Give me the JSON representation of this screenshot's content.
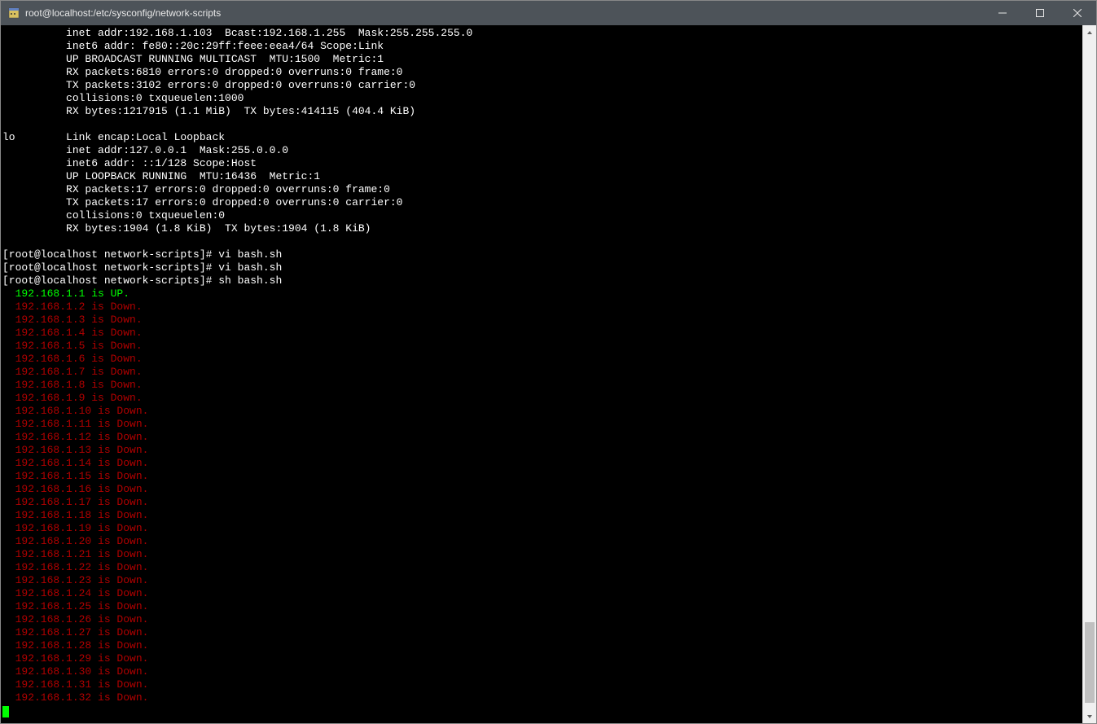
{
  "title_bar": {
    "title": "root@localhost:/etc/sysconfig/network-scripts"
  },
  "terminal": {
    "ifconfig_block": "          inet addr:192.168.1.103  Bcast:192.168.1.255  Mask:255.255.255.0\n          inet6 addr: fe80::20c:29ff:feee:eea4/64 Scope:Link\n          UP BROADCAST RUNNING MULTICAST  MTU:1500  Metric:1\n          RX packets:6810 errors:0 dropped:0 overruns:0 frame:0\n          TX packets:3102 errors:0 dropped:0 overruns:0 carrier:0\n          collisions:0 txqueuelen:1000\n          RX bytes:1217915 (1.1 MiB)  TX bytes:414115 (404.4 KiB)",
    "lo_block": "lo        Link encap:Local Loopback\n          inet addr:127.0.0.1  Mask:255.0.0.0\n          inet6 addr: ::1/128 Scope:Host\n          UP LOOPBACK RUNNING  MTU:16436  Metric:1\n          RX packets:17 errors:0 dropped:0 overruns:0 frame:0\n          TX packets:17 errors:0 dropped:0 overruns:0 carrier:0\n          collisions:0 txqueuelen:0\n          RX bytes:1904 (1.8 KiB)  TX bytes:1904 (1.8 KiB)",
    "prompts": [
      "[root@localhost network-scripts]# vi bash.sh",
      "[root@localhost network-scripts]# vi bash.sh",
      "[root@localhost network-scripts]# sh bash.sh"
    ],
    "results": [
      {
        "text": "192.168.1.1 is UP.",
        "status": "up"
      },
      {
        "text": "192.168.1.2 is Down.",
        "status": "down"
      },
      {
        "text": "192.168.1.3 is Down.",
        "status": "down"
      },
      {
        "text": "192.168.1.4 is Down.",
        "status": "down"
      },
      {
        "text": "192.168.1.5 is Down.",
        "status": "down"
      },
      {
        "text": "192.168.1.6 is Down.",
        "status": "down"
      },
      {
        "text": "192.168.1.7 is Down.",
        "status": "down"
      },
      {
        "text": "192.168.1.8 is Down.",
        "status": "down"
      },
      {
        "text": "192.168.1.9 is Down.",
        "status": "down"
      },
      {
        "text": "192.168.1.10 is Down.",
        "status": "down"
      },
      {
        "text": "192.168.1.11 is Down.",
        "status": "down"
      },
      {
        "text": "192.168.1.12 is Down.",
        "status": "down"
      },
      {
        "text": "192.168.1.13 is Down.",
        "status": "down"
      },
      {
        "text": "192.168.1.14 is Down.",
        "status": "down"
      },
      {
        "text": "192.168.1.15 is Down.",
        "status": "down"
      },
      {
        "text": "192.168.1.16 is Down.",
        "status": "down"
      },
      {
        "text": "192.168.1.17 is Down.",
        "status": "down"
      },
      {
        "text": "192.168.1.18 is Down.",
        "status": "down"
      },
      {
        "text": "192.168.1.19 is Down.",
        "status": "down"
      },
      {
        "text": "192.168.1.20 is Down.",
        "status": "down"
      },
      {
        "text": "192.168.1.21 is Down.",
        "status": "down"
      },
      {
        "text": "192.168.1.22 is Down.",
        "status": "down"
      },
      {
        "text": "192.168.1.23 is Down.",
        "status": "down"
      },
      {
        "text": "192.168.1.24 is Down.",
        "status": "down"
      },
      {
        "text": "192.168.1.25 is Down.",
        "status": "down"
      },
      {
        "text": "192.168.1.26 is Down.",
        "status": "down"
      },
      {
        "text": "192.168.1.27 is Down.",
        "status": "down"
      },
      {
        "text": "192.168.1.28 is Down.",
        "status": "down"
      },
      {
        "text": "192.168.1.29 is Down.",
        "status": "down"
      },
      {
        "text": "192.168.1.30 is Down.",
        "status": "down"
      },
      {
        "text": "192.168.1.31 is Down.",
        "status": "down"
      },
      {
        "text": "192.168.1.32 is Down.",
        "status": "down"
      }
    ]
  },
  "scrollbar": {
    "thumb_top_pct": 87,
    "thumb_height_pct": 12
  }
}
